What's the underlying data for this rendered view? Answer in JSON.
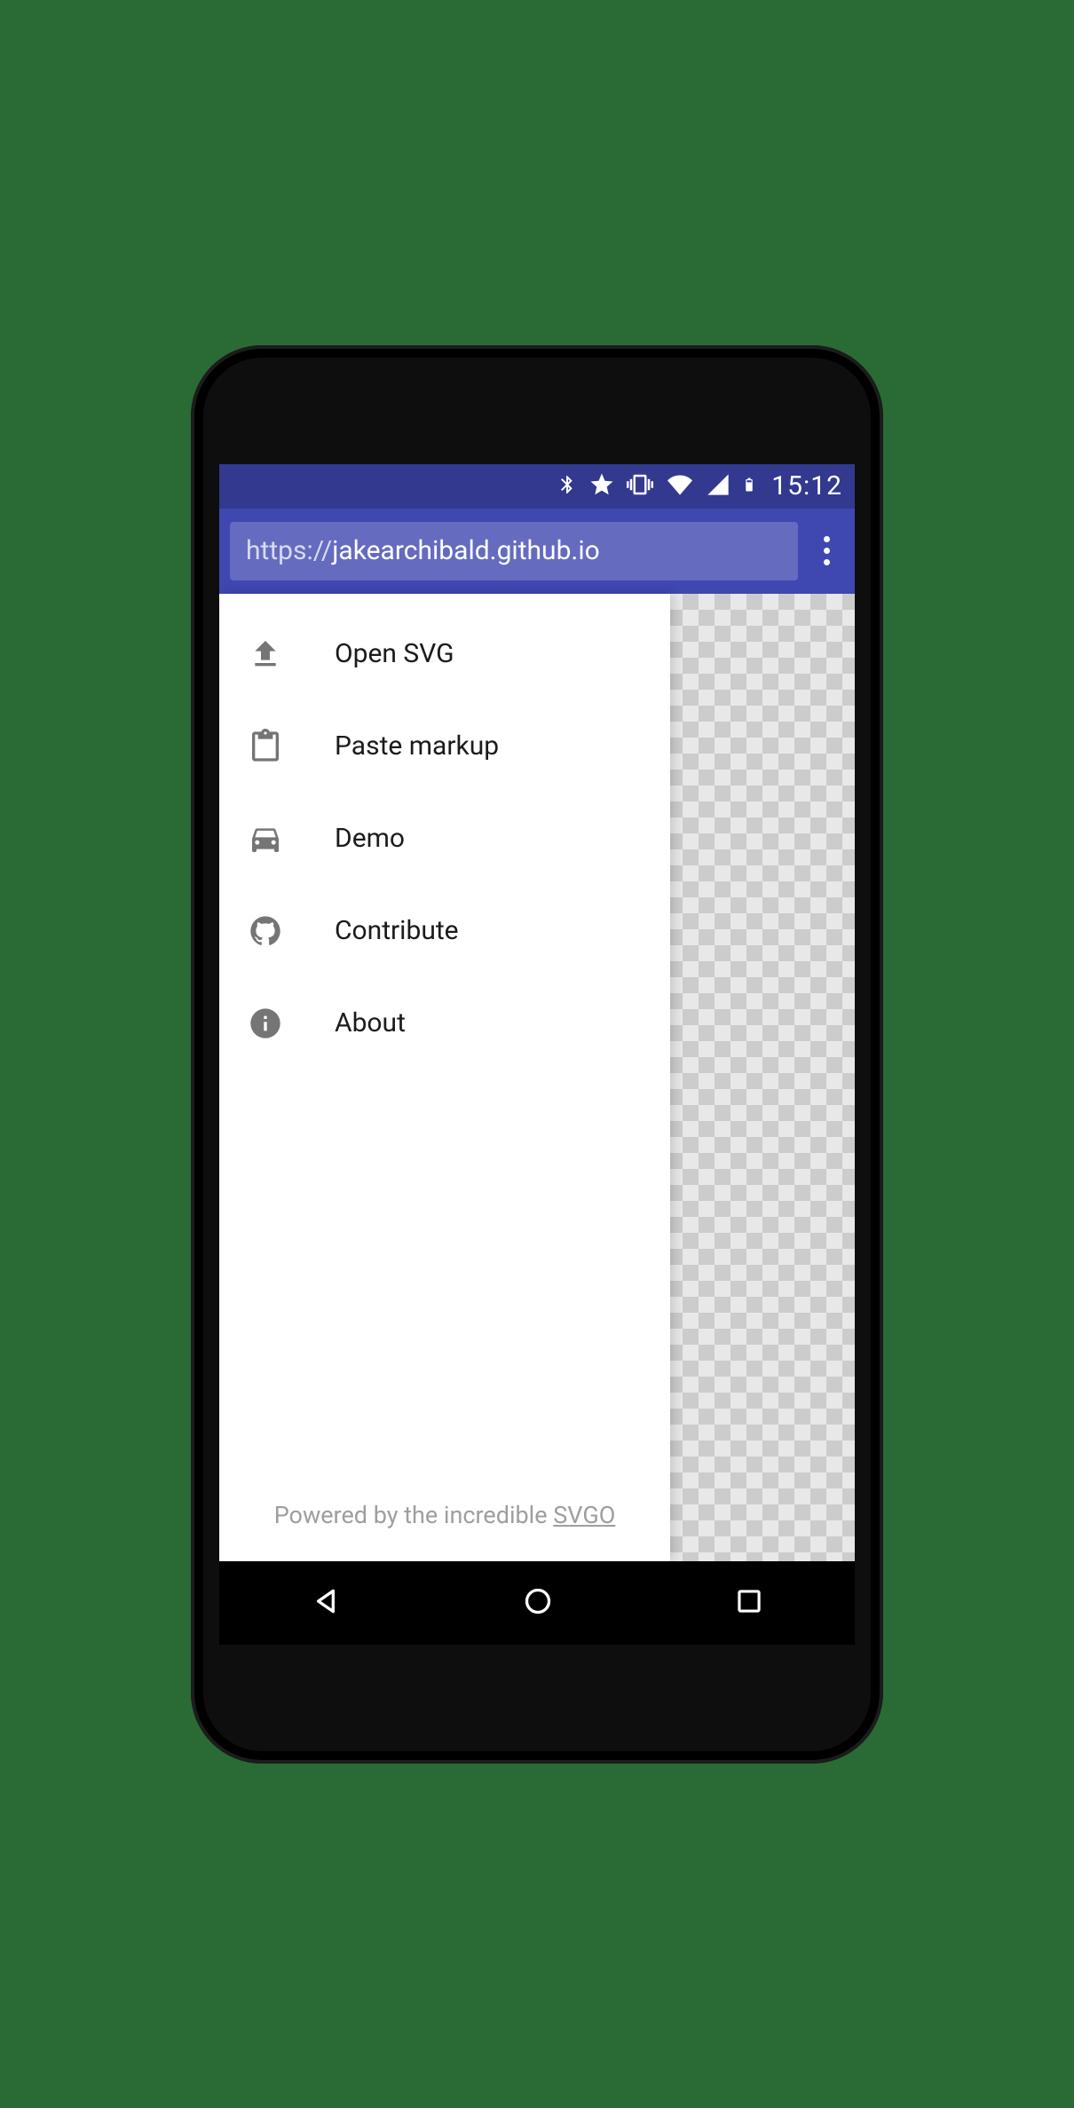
{
  "status": {
    "time": "15:12"
  },
  "browser": {
    "scheme": "https://",
    "host": "jakearchibald.github.io"
  },
  "drawer": {
    "items": [
      {
        "icon": "upload-icon",
        "label": "Open SVG"
      },
      {
        "icon": "clipboard-icon",
        "label": "Paste markup"
      },
      {
        "icon": "car-icon",
        "label": "Demo"
      },
      {
        "icon": "github-icon",
        "label": "Contribute"
      },
      {
        "icon": "info-icon",
        "label": "About"
      }
    ],
    "footer_prefix": "Powered by the incredible ",
    "footer_link": "SVGO"
  }
}
